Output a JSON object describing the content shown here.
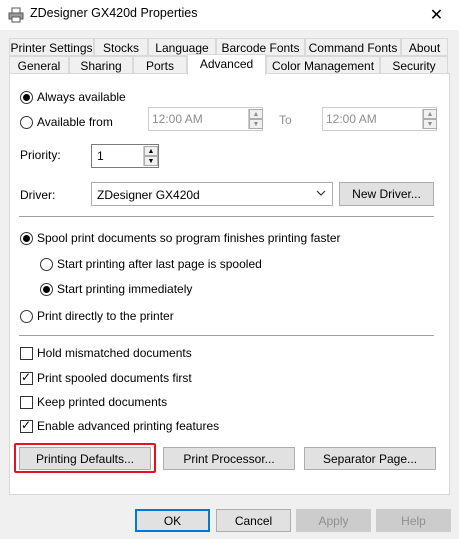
{
  "window": {
    "title": "ZDesigner GX420d Properties",
    "close": "✕"
  },
  "tabs_row1": [
    "Printer Settings",
    "Stocks",
    "Language",
    "Barcode Fonts",
    "Command Fonts",
    "About"
  ],
  "tabs_row2": [
    "General",
    "Sharing",
    "Ports",
    "Advanced",
    "Color Management",
    "Security"
  ],
  "availability": {
    "always_label": "Always available",
    "from_label": "Available from",
    "from_time": "12:00 AM",
    "to_label": "To",
    "to_time": "12:00 AM",
    "selected": "always"
  },
  "priority": {
    "label": "Priority:",
    "value": "1"
  },
  "driver": {
    "label": "Driver:",
    "value": "ZDesigner GX420d",
    "new_driver_button": "New Driver..."
  },
  "spool": {
    "spool_label": "Spool print documents so program finishes printing faster",
    "after_last_page_label": "Start printing after last page is spooled",
    "immediately_label": "Start printing immediately",
    "direct_label": "Print directly to the printer"
  },
  "options": {
    "hold_mismatched": {
      "label": "Hold mismatched documents",
      "checked": false
    },
    "spooled_first": {
      "label": "Print spooled documents first",
      "checked": true
    },
    "keep_printed": {
      "label": "Keep printed documents",
      "checked": false
    },
    "advanced_features": {
      "label": "Enable advanced printing features",
      "checked": true
    }
  },
  "panel_buttons": {
    "printing_defaults": "Printing Defaults...",
    "print_processor": "Print Processor...",
    "separator_page": "Separator Page..."
  },
  "highlight_color": "#e81123",
  "dialog_buttons": {
    "ok": "OK",
    "cancel": "Cancel",
    "apply": "Apply",
    "help": "Help"
  }
}
